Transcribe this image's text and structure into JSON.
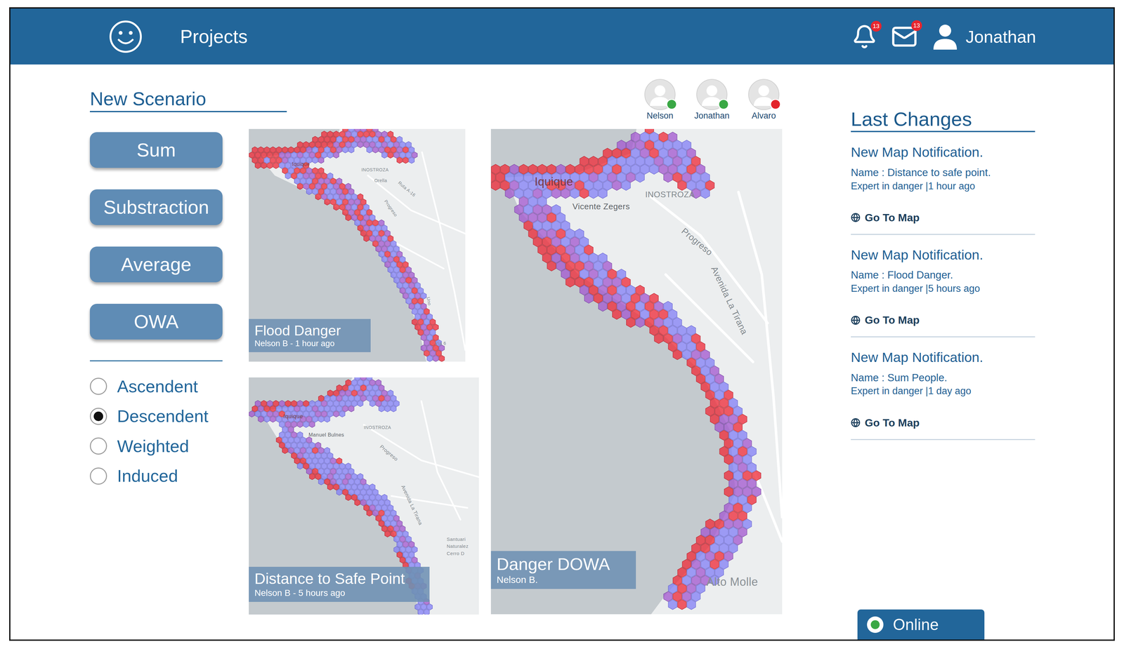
{
  "header": {
    "title": "Projects",
    "user": "Jonathan",
    "notifications": "13",
    "messages": "13"
  },
  "scenario": {
    "title": "New Scenario",
    "operations": [
      "Sum",
      "Substraction",
      "Average",
      "OWA"
    ],
    "orderings": [
      {
        "label": "Ascendent",
        "selected": false
      },
      {
        "label": "Descendent",
        "selected": true
      },
      {
        "label": "Weighted",
        "selected": false
      },
      {
        "label": "Induced",
        "selected": false
      }
    ]
  },
  "collaborators": [
    {
      "name": "Nelson",
      "color": "#3aa845"
    },
    {
      "name": "Jonathan",
      "color": "#3aa845"
    },
    {
      "name": "Alvaro",
      "color": "#e3242b"
    }
  ],
  "maps": [
    {
      "title": "Flood Danger",
      "subtitle": "Nelson B - 1 hour ago",
      "labels": [
        "Iquique",
        "INOSTROZA",
        "Orella",
        "Ruta A-16",
        "Progreso",
        "Uno",
        "Vía 6"
      ]
    },
    {
      "title": "Distance to Safe Point",
      "subtitle": "Nelson B - 5 hours ago",
      "labels": [
        "Iquique",
        "INOSTROZA",
        "Manuel Bulnes",
        "Progreso",
        "Avenida La Tirana",
        "Santuari",
        "Naturalez",
        "Cerro D"
      ]
    },
    {
      "title": "Danger DOWA",
      "subtitle": "Nelson B.",
      "labels": [
        "Iquique",
        "Vicente Zegers",
        "INOSTROZA",
        "Progreso",
        "Avenida La Tirana",
        "Alto Molle"
      ]
    }
  ],
  "last_changes": {
    "title": "Last Changes",
    "items": [
      {
        "title": "New Map Notification.",
        "name": "Name : Distance to safe point.",
        "meta": "Expert in danger |1 hour ago",
        "link": "Go To Map"
      },
      {
        "title": "New Map Notification.",
        "name": "Name : Flood Danger.",
        "meta": "Expert in danger |5 hours ago",
        "link": "Go To Map"
      },
      {
        "title": "New Map Notification.",
        "name": "Name : Sum People.",
        "meta": "Expert in danger |1 day ago",
        "link": "Go To Map"
      }
    ]
  },
  "status": {
    "label": "Online",
    "online": true
  }
}
